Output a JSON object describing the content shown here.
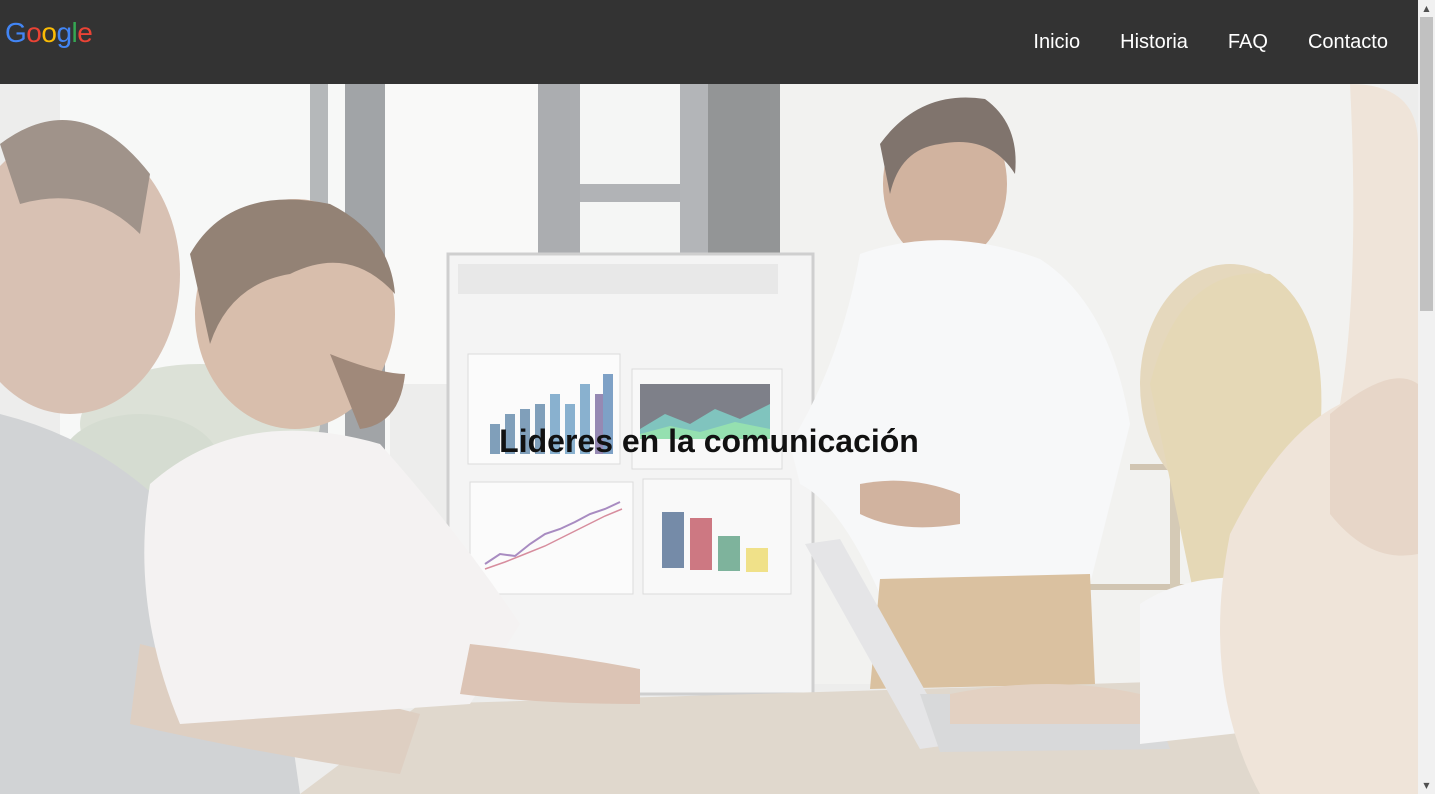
{
  "nav": {
    "logo": {
      "letters": [
        "G",
        "o",
        "o",
        "g",
        "l",
        "e"
      ],
      "colors": [
        "#4285F4",
        "#EA4335",
        "#FBBC05",
        "#4285F4",
        "#34A853",
        "#EA4335"
      ]
    },
    "links": [
      "Inicio",
      "Historia",
      "FAQ",
      "Contacto"
    ]
  },
  "hero": {
    "title": "Lideres en la comunicación"
  },
  "colors": {
    "navbar_bg": "#333333",
    "nav_text": "#ffffff",
    "hero_title": "#111111"
  },
  "scrollbar": {
    "up_icon": "triangle-up-icon",
    "down_icon": "triangle-down-icon"
  }
}
